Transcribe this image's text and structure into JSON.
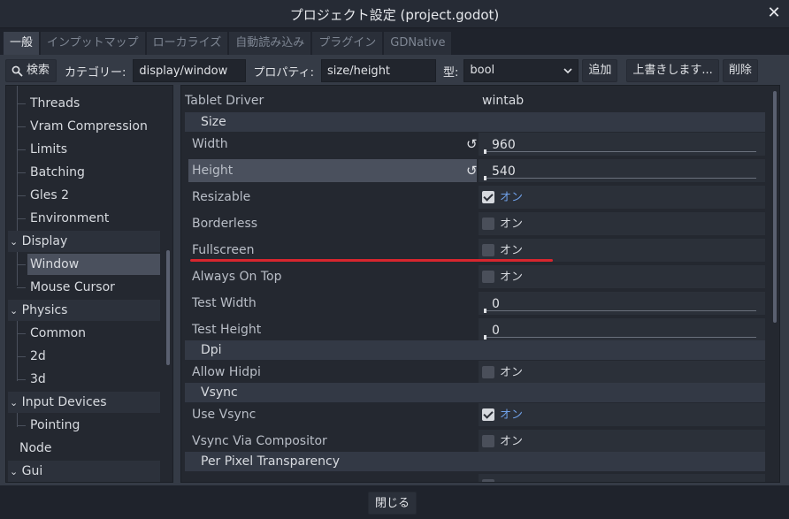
{
  "window": {
    "title": "プロジェクト設定 (project.godot)",
    "close_glyph": "✕"
  },
  "tabs": [
    {
      "label": "一般",
      "active": true
    },
    {
      "label": "インプットマップ",
      "active": false
    },
    {
      "label": "ローカライズ",
      "active": false
    },
    {
      "label": "自動読み込み",
      "active": false
    },
    {
      "label": "プラグイン",
      "active": false
    },
    {
      "label": "GDNative",
      "active": false
    }
  ],
  "toolbar": {
    "search_label": "検索",
    "category_label": "カテゴリー:",
    "category_value": "display/window",
    "property_label": "プロパティ:",
    "property_value": "size/height",
    "type_label": "型:",
    "type_value": "bool",
    "add_label": "追加",
    "override_label": "上書きします...",
    "delete_label": "削除"
  },
  "tree": {
    "items": [
      {
        "label": "Threads",
        "level": 1
      },
      {
        "label": "Vram Compression",
        "level": 1
      },
      {
        "label": "Limits",
        "level": 1
      },
      {
        "label": "Batching",
        "level": 1
      },
      {
        "label": "Gles 2",
        "level": 1
      },
      {
        "label": "Environment",
        "level": 1
      },
      {
        "label": "Display",
        "level": 0,
        "expanded": true
      },
      {
        "label": "Window",
        "level": 1,
        "selected": true
      },
      {
        "label": "Mouse Cursor",
        "level": 1
      },
      {
        "label": "Physics",
        "level": 0,
        "expanded": true
      },
      {
        "label": "Common",
        "level": 1
      },
      {
        "label": "2d",
        "level": 1
      },
      {
        "label": "3d",
        "level": 1
      },
      {
        "label": "Input Devices",
        "level": 0,
        "expanded": true
      },
      {
        "label": "Pointing",
        "level": 1
      },
      {
        "label": "Node",
        "level": 0
      },
      {
        "label": "Gui",
        "level": 0,
        "expanded": true
      }
    ]
  },
  "inspector": {
    "tablet_driver": {
      "name": "Tablet Driver",
      "value": "wintab"
    },
    "section_size": "Size",
    "width": {
      "name": "Width",
      "value": "960"
    },
    "height": {
      "name": "Height",
      "value": "540"
    },
    "resizable": {
      "name": "Resizable",
      "checked": true,
      "text": "オン"
    },
    "borderless": {
      "name": "Borderless",
      "checked": false,
      "text": "オン"
    },
    "fullscreen": {
      "name": "Fullscreen",
      "checked": false,
      "text": "オン"
    },
    "always_on_top": {
      "name": "Always On Top",
      "checked": false,
      "text": "オン"
    },
    "test_width": {
      "name": "Test Width",
      "value": "0"
    },
    "test_height": {
      "name": "Test Height",
      "value": "0"
    },
    "section_dpi": "Dpi",
    "allow_hidpi": {
      "name": "Allow Hidpi",
      "checked": false,
      "text": "オン"
    },
    "section_vsync": "Vsync",
    "use_vsync": {
      "name": "Use Vsync",
      "checked": true,
      "text": "オン"
    },
    "vsync_compositor": {
      "name": "Vsync Via Compositor",
      "checked": false,
      "text": "オン"
    },
    "section_ppt": "Per Pixel Transparency"
  },
  "footer": {
    "close_label": "閉じる"
  },
  "colors": {
    "accent": "#6fa0e8",
    "annotation": "#d8262e"
  }
}
